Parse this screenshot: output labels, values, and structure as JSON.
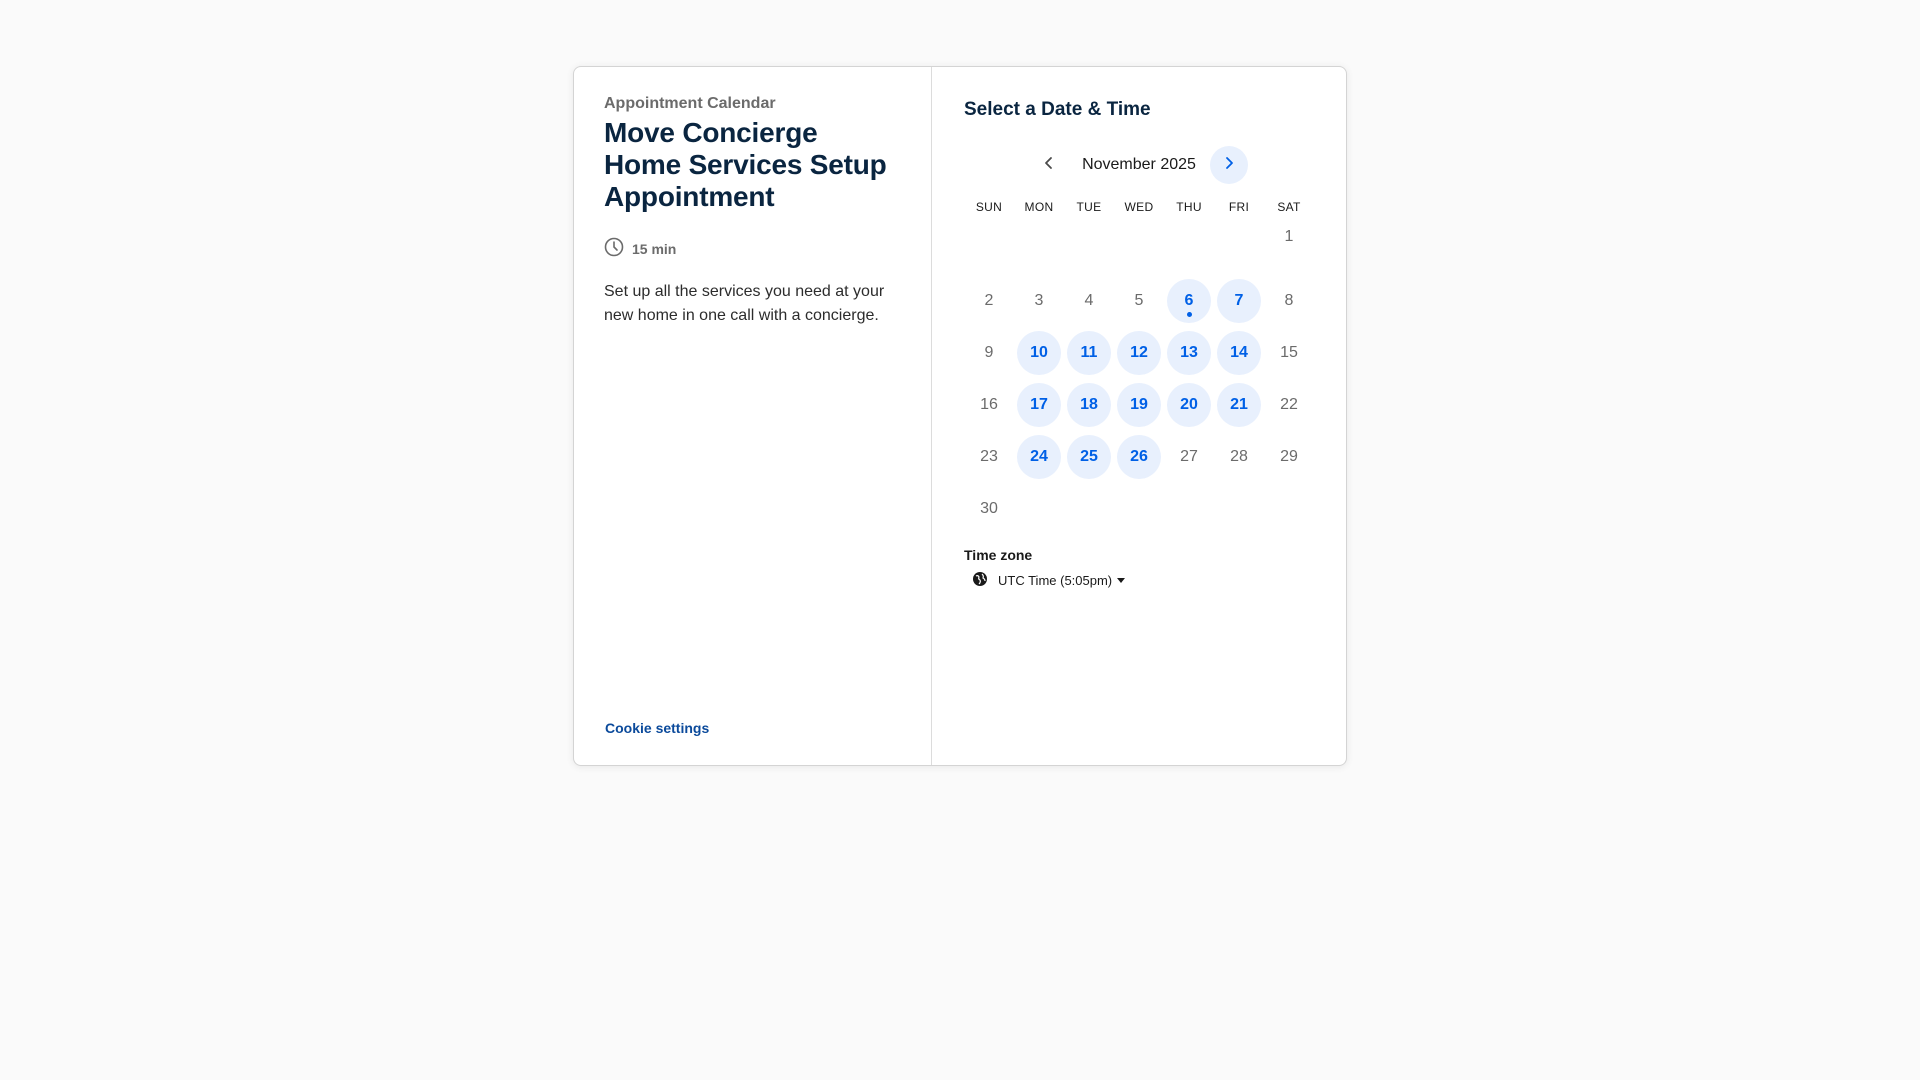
{
  "left_panel": {
    "org_name": "Appointment Calendar",
    "event_title": "Move Concierge Home Services Setup Appointment",
    "duration": "15 min",
    "description": "Set up all the services you need at your new home in one call with a concierge.",
    "cookie_settings": "Cookie settings"
  },
  "right_panel": {
    "title": "Select a Date & Time",
    "month_label": "November 2025",
    "weekdays": [
      "SUN",
      "MON",
      "TUE",
      "WED",
      "THU",
      "FRI",
      "SAT"
    ],
    "days": [
      {
        "label": "1",
        "available": false,
        "today": false
      },
      {
        "label": "2",
        "available": false,
        "today": false
      },
      {
        "label": "3",
        "available": false,
        "today": false
      },
      {
        "label": "4",
        "available": false,
        "today": false
      },
      {
        "label": "5",
        "available": false,
        "today": false
      },
      {
        "label": "6",
        "available": true,
        "today": true
      },
      {
        "label": "7",
        "available": true,
        "today": false
      },
      {
        "label": "8",
        "available": false,
        "today": false
      },
      {
        "label": "9",
        "available": false,
        "today": false
      },
      {
        "label": "10",
        "available": true,
        "today": false
      },
      {
        "label": "11",
        "available": true,
        "today": false
      },
      {
        "label": "12",
        "available": true,
        "today": false
      },
      {
        "label": "13",
        "available": true,
        "today": false
      },
      {
        "label": "14",
        "available": true,
        "today": false
      },
      {
        "label": "15",
        "available": false,
        "today": false
      },
      {
        "label": "16",
        "available": false,
        "today": false
      },
      {
        "label": "17",
        "available": true,
        "today": false
      },
      {
        "label": "18",
        "available": true,
        "today": false
      },
      {
        "label": "19",
        "available": true,
        "today": false
      },
      {
        "label": "20",
        "available": true,
        "today": false
      },
      {
        "label": "21",
        "available": true,
        "today": false
      },
      {
        "label": "22",
        "available": false,
        "today": false
      },
      {
        "label": "23",
        "available": false,
        "today": false
      },
      {
        "label": "24",
        "available": true,
        "today": false
      },
      {
        "label": "25",
        "available": true,
        "today": false
      },
      {
        "label": "26",
        "available": true,
        "today": false
      },
      {
        "label": "27",
        "available": false,
        "today": false
      },
      {
        "label": "28",
        "available": false,
        "today": false
      },
      {
        "label": "29",
        "available": false,
        "today": false
      },
      {
        "label": "30",
        "available": false,
        "today": false
      }
    ],
    "timezone_label": "Time zone",
    "timezone_value": "UTC Time (5:05pm)"
  },
  "icons": {
    "duration": "clock-icon",
    "prev_month": "chevron-left-icon",
    "next_month": "chevron-right-icon",
    "timezone": "globe-icon",
    "timezone_dropdown": "caret-down-icon"
  },
  "colors": {
    "accent": "#0060e6",
    "available_bg": "#e8f0fd",
    "title": "#0a2540",
    "link": "#0b4a9b"
  }
}
